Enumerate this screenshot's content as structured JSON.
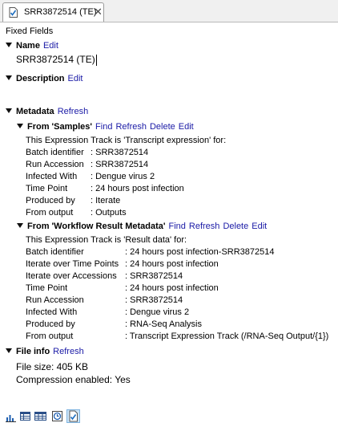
{
  "tab": {
    "title": "SRR3872514 (TE)",
    "close": "✕"
  },
  "fixed_fields": "Fixed Fields",
  "name": {
    "heading": "Name",
    "edit": "Edit",
    "value": "SRR3872514 (TE)"
  },
  "description": {
    "heading": "Description",
    "edit": "Edit"
  },
  "metadata": {
    "heading": "Metadata",
    "refresh": "Refresh",
    "samples": {
      "heading": "From 'Samples'",
      "links": [
        "Find",
        "Refresh",
        "Delete",
        "Edit"
      ],
      "intro": "This Expression Track is 'Transcript expression' for:",
      "rows": [
        {
          "label": "Batch identifier",
          "value": ": SRR3872514"
        },
        {
          "label": "Run Accession",
          "value": ": SRR3872514"
        },
        {
          "label": "Infected With",
          "value": ": Dengue virus 2"
        },
        {
          "label": "Time Point",
          "value": ": 24 hours post infection"
        },
        {
          "label": "Produced by",
          "value": ": Iterate"
        },
        {
          "label": "From output",
          "value": ": Outputs"
        }
      ]
    },
    "workflow": {
      "heading": "From 'Workflow Result Metadata'",
      "links": [
        "Find",
        "Refresh",
        "Delete",
        "Edit"
      ],
      "intro": "This Expression Track is 'Result data' for:",
      "rows": [
        {
          "label": "Batch identifier",
          "value": ": 24 hours post infection-SRR3872514"
        },
        {
          "label": "Iterate over Time Points",
          "value": ": 24 hours post infection"
        },
        {
          "label": "Iterate over Accessions",
          "value": ": SRR3872514"
        },
        {
          "label": "Time Point",
          "value": ": 24 hours post infection"
        },
        {
          "label": "Run Accession",
          "value": ": SRR3872514"
        },
        {
          "label": "Infected With",
          "value": ": Dengue virus 2"
        },
        {
          "label": "Produced by",
          "value": ": RNA-Seq Analysis"
        },
        {
          "label": "From output",
          "value": ": Transcript Expression Track (/RNA-Seq Output/{1})"
        }
      ]
    }
  },
  "file_info": {
    "heading": "File info",
    "refresh": "Refresh",
    "size": "File size: 405 KB",
    "compression": "Compression enabled: Yes"
  },
  "bottom_icons": [
    "bar-chart-icon",
    "table-icon",
    "grid-table-icon",
    "history-icon",
    "element-info-icon"
  ]
}
